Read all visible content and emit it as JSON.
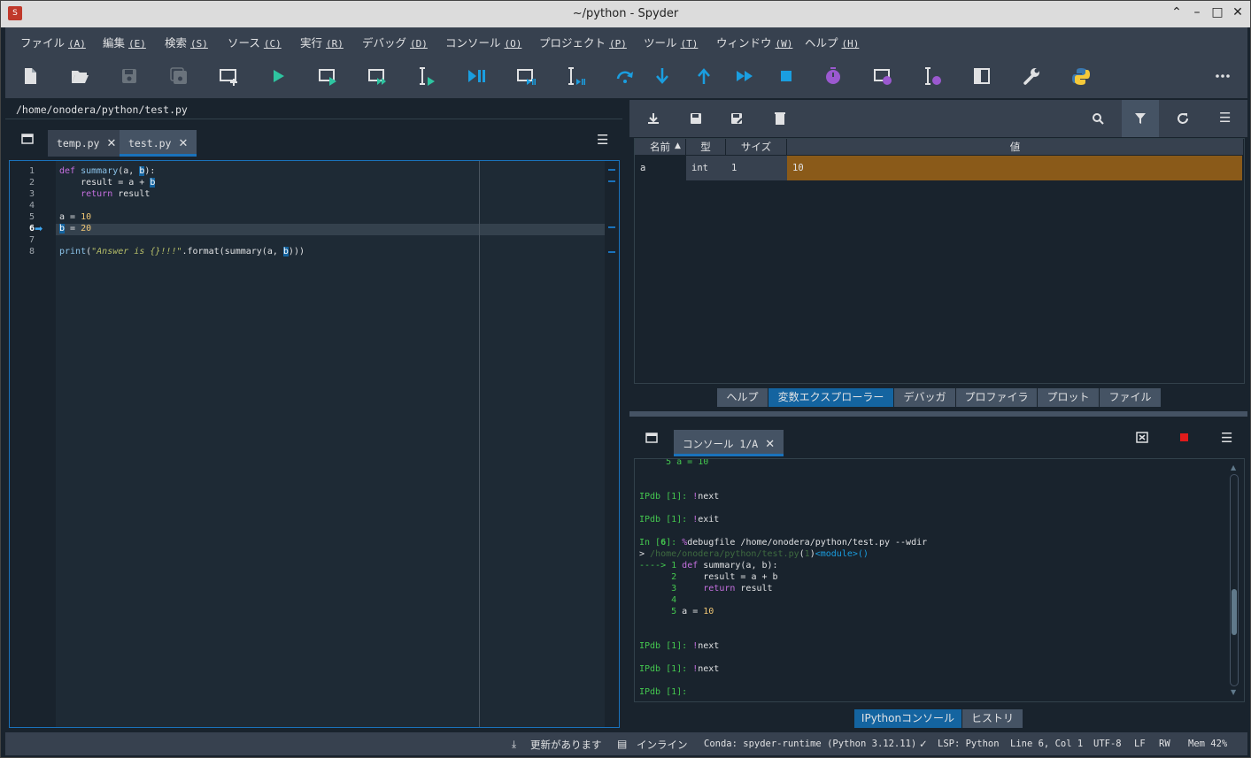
{
  "window": {
    "title": "~/python - Spyder"
  },
  "menu": [
    {
      "label": "ファイル",
      "key": "(A)"
    },
    {
      "label": "編集",
      "key": "(E)"
    },
    {
      "label": "検索",
      "key": "(S)"
    },
    {
      "label": "ソース",
      "key": "(C)"
    },
    {
      "label": "実行",
      "key": "(R)"
    },
    {
      "label": "デバッグ",
      "key": "(D)"
    },
    {
      "label": "コンソール",
      "key": "(O)"
    },
    {
      "label": "プロジェクト",
      "key": "(P)"
    },
    {
      "label": "ツール",
      "key": "(T)"
    },
    {
      "label": "ウィンドウ",
      "key": "(W)"
    },
    {
      "label": "ヘルプ",
      "key": "(H)"
    }
  ],
  "toolbar_icons": [
    "new-file-icon",
    "open-file-icon",
    "save-icon",
    "save-all-icon",
    "new-cell-icon",
    "run-icon",
    "run-cell-icon",
    "run-cell-advance-icon",
    "run-selection-icon",
    "debug-icon",
    "debug-cell-icon",
    "debug-selection-icon",
    "step-over-icon",
    "step-into-icon",
    "step-return-icon",
    "continue-icon",
    "stop-icon",
    "profile-icon",
    "profile-cell-icon",
    "profile-selection-icon",
    "maximize-pane-icon",
    "preferences-icon",
    "python-path-icon",
    "more-icon"
  ],
  "editor": {
    "path": "/home/onodera/python/test.py",
    "tabs": [
      {
        "label": "temp.py"
      },
      {
        "label": "test.py"
      }
    ],
    "line_numbers": [
      "1",
      "2",
      "3",
      "4",
      "5",
      "6",
      "7",
      "8"
    ],
    "current_line": "6"
  },
  "variables": {
    "headers": {
      "name": "名前",
      "type": "型",
      "size": "サイズ",
      "value": "値"
    },
    "rows": [
      {
        "name": "a",
        "type": "int",
        "size": "1",
        "value": "10"
      }
    ],
    "highlight_color": "#8a5a19"
  },
  "pane_tabs": [
    "ヘルプ",
    "変数エクスプローラー",
    "デバッガ",
    "プロファイラ",
    "プロット",
    "ファイル"
  ],
  "console": {
    "tab_label": "コンソール 1/A",
    "lines": [
      "     5 a = 10",
      "",
      "",
      "IPdb [1]: !next",
      "",
      "IPdb [1]: !exit",
      "",
      "In [6]: %debugfile /home/onodera/python/test.py --wdir",
      "> /home/onodera/python/test.py(1)<module>()",
      "----> 1 def summary(a, b):",
      "      2     result = a + b",
      "      3     return result",
      "      4",
      "      5 a = 10",
      "",
      "",
      "IPdb [1]: !next",
      "",
      "IPdb [1]: !next",
      "",
      "IPdb [1]: "
    ]
  },
  "console_tabs": [
    "IPythonコンソール",
    "ヒストリ"
  ],
  "status": {
    "update": "更新があります",
    "inline": "インライン",
    "conda": "Conda: spyder-runtime (Python 3.12.11)",
    "lsp": "LSP: Python",
    "position": "Line 6, Col 1",
    "encoding": "UTF-8",
    "eol": "LF",
    "perm": "RW",
    "mem": "Mem 42%"
  }
}
